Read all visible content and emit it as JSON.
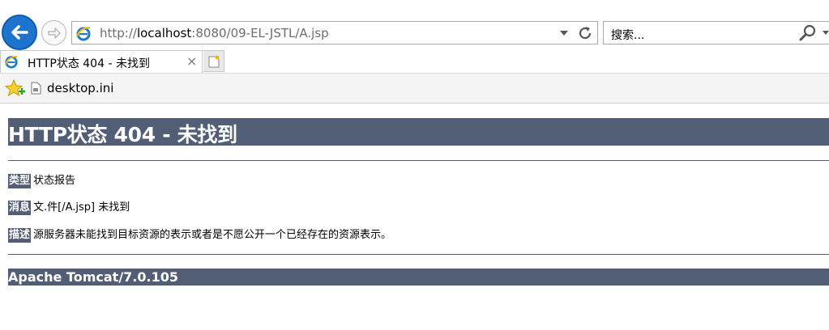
{
  "browser": {
    "url_prefix": "http://",
    "url_host": "localhost",
    "url_rest": ":8080/09-EL-JSTL/A.jsp",
    "search_placeholder": "搜索...",
    "tab_title": "HTTP状态 404 - 未找到",
    "tab_close": "×",
    "favorite_item": "desktop.ini",
    "accent": "#1d74cf"
  },
  "page": {
    "title": "HTTP状态 404 - 未找到",
    "type_label": "类型",
    "type_value": "状态报告",
    "message_label": "消息",
    "message_value": "文.件[/A.jsp] 未找到",
    "description_label": "描述",
    "description_value": "源服务器未能找到目标资源的表示或者是不愿公开一个已经存在的资源表示。",
    "footer": "Apache Tomcat/7.0.105",
    "bar_color": "#525d76"
  }
}
